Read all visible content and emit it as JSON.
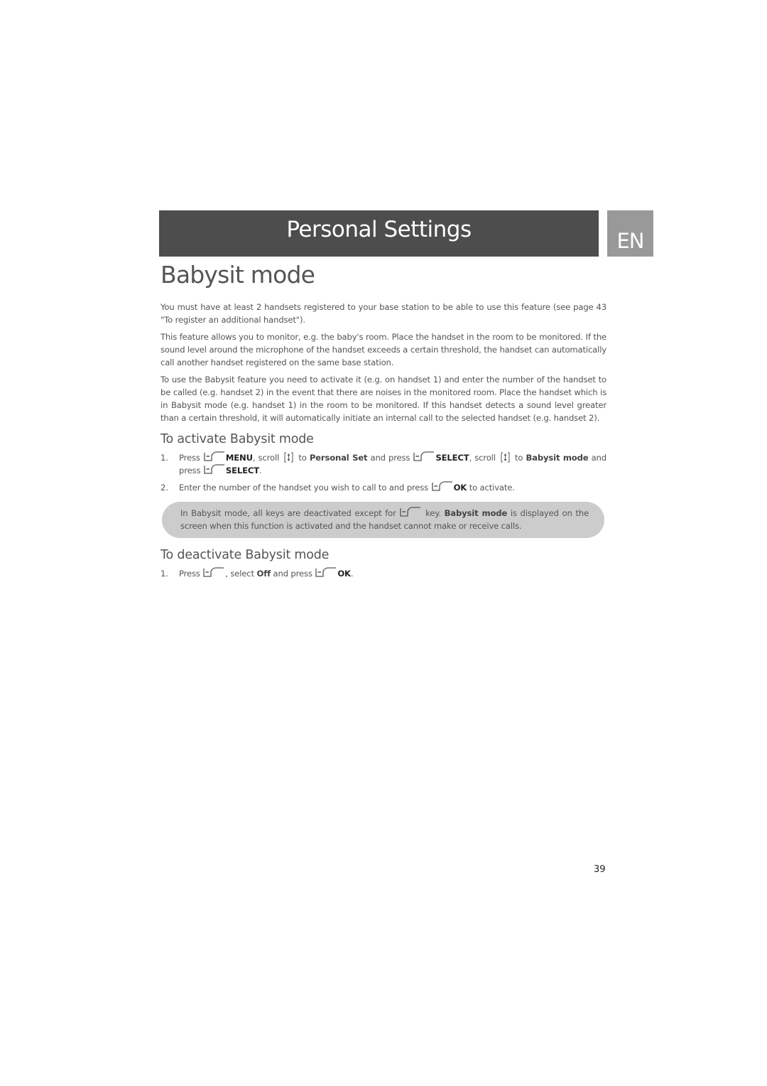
{
  "header": {
    "title": "Personal Settings",
    "language_badge": "EN",
    "colors": {
      "bar": "#4d4d4d",
      "badge": "#999999",
      "text": "#ffffff"
    }
  },
  "page_title": "Babysit mode",
  "intro_paragraphs": [
    "You must have at least 2 handsets registered to your base station to be able to use this feature (see page 43 \"To register an additional handset\").",
    "This feature allows you to monitor, e.g. the baby's room. Place the handset in the room to be monitored. If the sound level around the microphone of the handset exceeds a certain threshold, the handset can automatically call another handset registered on the same base station.",
    "To use the Babysit feature you need to activate it (e.g. on handset 1) and enter the number of the handset to be called (e.g. handset 2) in the event that there are noises in the monitored room. Place the handset which is in Babysit mode (e.g. handset 1) in the room to be monitored. If this handset detects a sound level greater than a certain threshold, it will automatically initiate an internal call to the selected handset (e.g. handset 2)."
  ],
  "activate": {
    "heading": "To activate Babysit mode",
    "steps": [
      {
        "num": "1.",
        "t1": "Press",
        "k1": "MENU",
        "t2": ", scroll",
        "t3": "to",
        "b1": "Personal Set",
        "t4": "and press",
        "k2": "SELECT",
        "t5": ", scroll",
        "t6": "to",
        "b2": "Babysit mode",
        "t7": "and press",
        "k3": "SELECT",
        "t8": "."
      },
      {
        "num": "2.",
        "t1": "Enter the number of the handset you wish to call to and press",
        "k1": "OK",
        "t2": "to activate."
      }
    ]
  },
  "note": {
    "t1": "In Babysit mode, all keys are deactivated except for",
    "t2": "key.",
    "b1": "Babysit mode",
    "t3": "is displayed on the screen when this function is activated and the handset cannot make or receive calls.",
    "background": "#cccccc"
  },
  "deactivate": {
    "heading": "To deactivate Babysit mode",
    "steps": [
      {
        "num": "1.",
        "t1": "Press",
        "t2": ", select",
        "b1": "Off",
        "t3": "and press",
        "k1": "OK",
        "t4": "."
      }
    ]
  },
  "icons": {
    "softkey": "left-softkey-icon",
    "scroll": "scroll-navigation-icon"
  },
  "page_number": "39"
}
